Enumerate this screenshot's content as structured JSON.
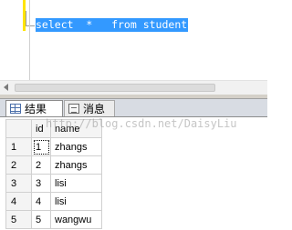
{
  "editor": {
    "query": "select  *   from student"
  },
  "tabs": [
    {
      "label": "结果",
      "icon": "results-grid-icon"
    },
    {
      "label": "消息",
      "icon": "messages-icon"
    }
  ],
  "grid": {
    "columns": [
      "id",
      "name"
    ],
    "rows": [
      {
        "num": "1",
        "id": "1",
        "name": "zhangs"
      },
      {
        "num": "2",
        "id": "2",
        "name": "zhangs"
      },
      {
        "num": "3",
        "id": "3",
        "name": "lisi"
      },
      {
        "num": "4",
        "id": "4",
        "name": "lisi"
      },
      {
        "num": "5",
        "id": "5",
        "name": "wangwu"
      }
    ]
  },
  "watermark": "http://blog.csdn.net/DaisyLiu"
}
